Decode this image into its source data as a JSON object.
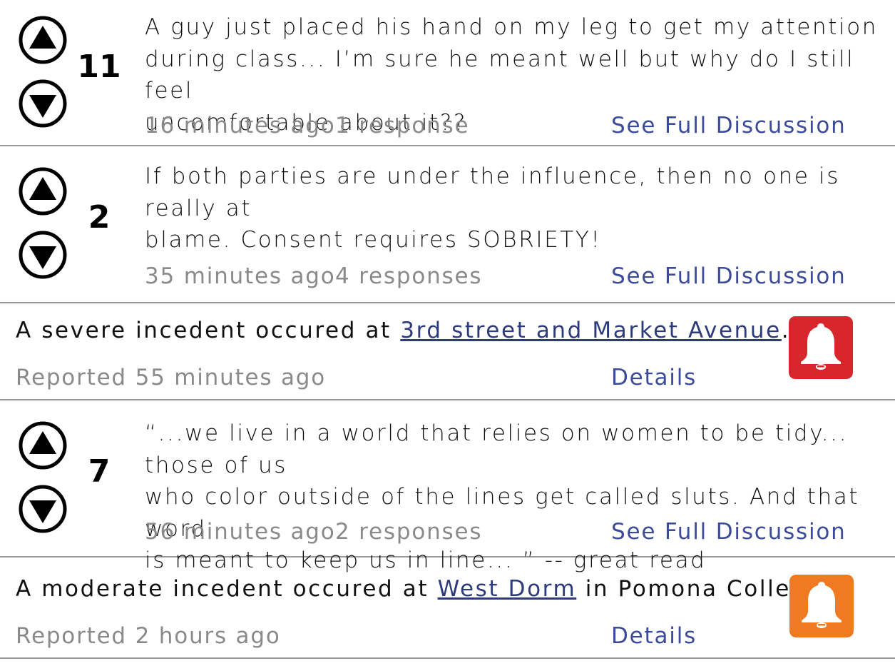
{
  "feed": [
    {
      "type": "post",
      "score": "11",
      "text": [
        "A guy just placed his hand on my leg to get my attention",
        "during class... I’m sure he meant well but why do I still feel",
        "uncomfortable about it??"
      ],
      "time": "16 minutes ago",
      "responses": "1 response",
      "link": "See Full Discussion"
    },
    {
      "type": "post",
      "score": "2",
      "text": [
        "If both parties are under the influence, then no one is really at",
        "blame. Consent requires SOBRIETY!"
      ],
      "time": "35 minutes ago",
      "responses": "4 responses",
      "link": "See Full Discussion"
    },
    {
      "type": "alert",
      "prefix": "A severe incedent occured at ",
      "location": "3rd street and Market Avenue",
      "suffix": ".",
      "reported": "Reported 55 minutes ago",
      "link": "Details",
      "color": "#d7262c"
    },
    {
      "type": "post",
      "score": "7",
      "text": [
        "“...we live in a world that relies on women to be tidy... those of us",
        "who color outside of the lines get called sluts. And that word",
        "is meant to keep us in line... ” -- great read"
      ],
      "time": "56 minutes ago",
      "responses": "2 responses",
      "link": "See Full Discussion"
    },
    {
      "type": "alert",
      "prefix": "A moderate incedent occured at ",
      "location": "West Dorm",
      "suffix": " in Pomona College.",
      "reported": "Reported 2 hours ago",
      "link": "Details",
      "color": "#f07a22"
    }
  ],
  "icons": {
    "upvote": "upvote-arrow-icon",
    "downvote": "downvote-arrow-icon",
    "alert": "bell-icon"
  }
}
